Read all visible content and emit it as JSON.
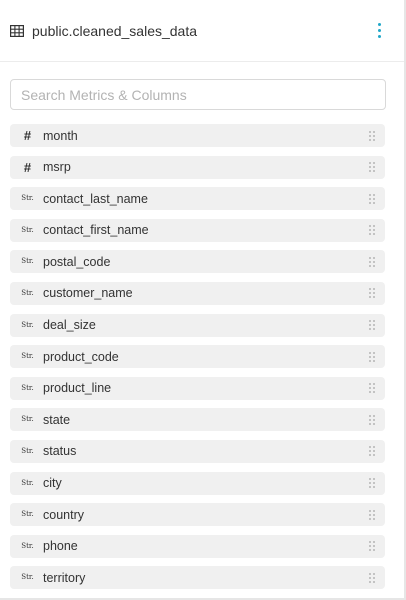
{
  "header": {
    "dataset_name": "public.cleaned_sales_data",
    "table_icon": "table-icon",
    "menu_icon": "more-vertical-icon",
    "accent_color": "#20a7c9"
  },
  "search": {
    "placeholder": "Search Metrics & Columns",
    "value": ""
  },
  "columns": [
    {
      "name": "month",
      "type_icon": "#"
    },
    {
      "name": "msrp",
      "type_icon": "#"
    },
    {
      "name": "contact_last_name",
      "type_icon": "Str."
    },
    {
      "name": "contact_first_name",
      "type_icon": "Str."
    },
    {
      "name": "postal_code",
      "type_icon": "Str."
    },
    {
      "name": "customer_name",
      "type_icon": "Str."
    },
    {
      "name": "deal_size",
      "type_icon": "Str."
    },
    {
      "name": "product_code",
      "type_icon": "Str."
    },
    {
      "name": "product_line",
      "type_icon": "Str."
    },
    {
      "name": "state",
      "type_icon": "Str."
    },
    {
      "name": "status",
      "type_icon": "Str."
    },
    {
      "name": "city",
      "type_icon": "Str."
    },
    {
      "name": "country",
      "type_icon": "Str."
    },
    {
      "name": "phone",
      "type_icon": "Str."
    },
    {
      "name": "territory",
      "type_icon": "Str."
    }
  ]
}
